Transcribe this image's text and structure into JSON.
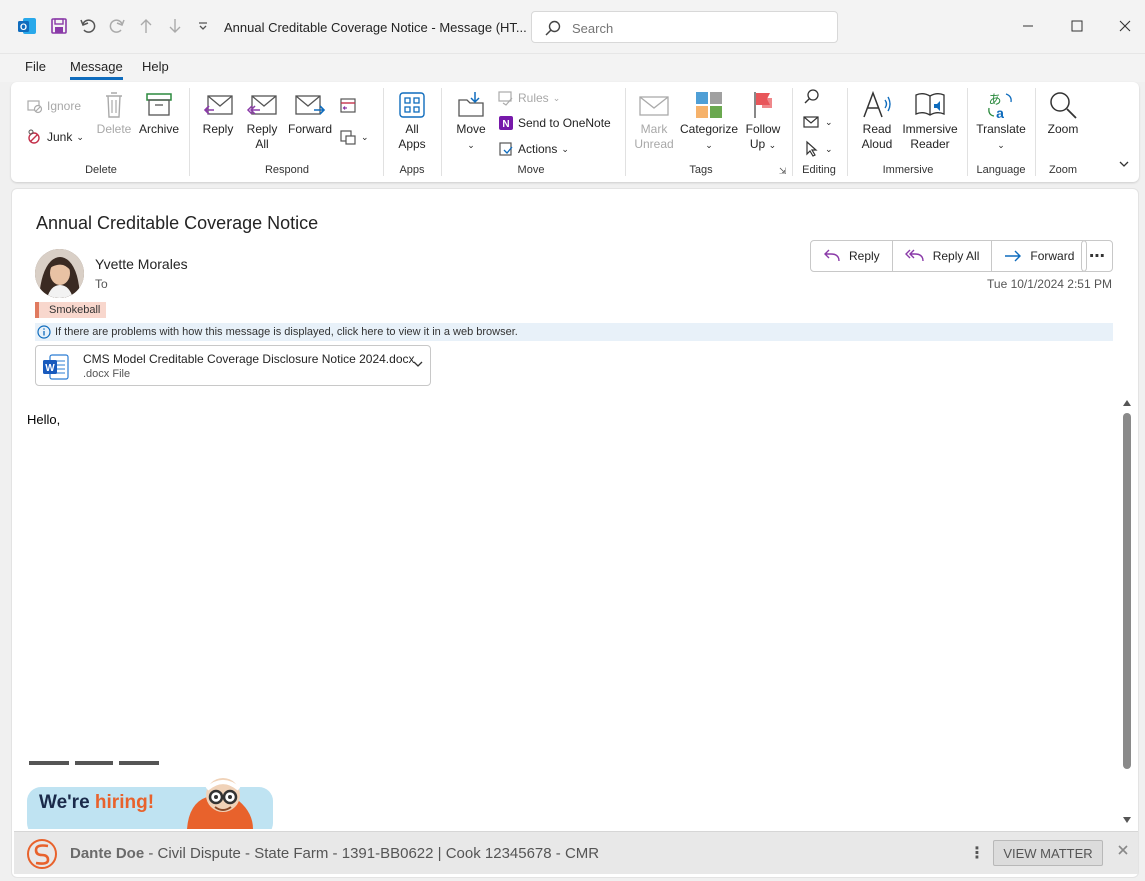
{
  "titlebar": {
    "title": "Annual Creditable Coverage Notice  -  Message (HT...",
    "search_placeholder": "Search"
  },
  "menu": {
    "file": "File",
    "message": "Message",
    "help": "Help"
  },
  "ribbon": {
    "delete_group": {
      "label": "Delete",
      "ignore": "Ignore",
      "junk": "Junk",
      "delete": "Delete",
      "archive": "Archive"
    },
    "respond_group": {
      "label": "Respond",
      "reply": "Reply",
      "reply_all_1": "Reply",
      "reply_all_2": "All",
      "forward": "Forward"
    },
    "apps_group": {
      "label": "Apps",
      "all_apps_1": "All",
      "all_apps_2": "Apps"
    },
    "move_group": {
      "label": "Move",
      "move": "Move",
      "rules": "Rules",
      "onenote": "Send to OneNote",
      "actions": "Actions"
    },
    "tags_group": {
      "label": "Tags",
      "mark_unread_1": "Mark",
      "mark_unread_2": "Unread",
      "categorize": "Categorize",
      "follow_up_1": "Follow",
      "follow_up_2": "Up"
    },
    "editing_group": {
      "label": "Editing"
    },
    "immersive_group": {
      "label": "Immersive",
      "read_aloud_1": "Read",
      "read_aloud_2": "Aloud",
      "immersive_reader_1": "Immersive",
      "immersive_reader_2": "Reader"
    },
    "language_group": {
      "label": "Language",
      "translate": "Translate"
    },
    "zoom_group": {
      "label": "Zoom",
      "zoom": "Zoom"
    }
  },
  "message": {
    "subject": "Annual Creditable Coverage Notice",
    "sender": "Yvette Morales",
    "to_label": "To",
    "datetime": "Tue 10/1/2024 2:51 PM",
    "category": "Smokeball",
    "info_bar": "If there are problems with how this message is displayed, click here to view it in a web browser.",
    "attachment": {
      "name": "CMS Model Creditable Coverage Disclosure Notice 2024.docx",
      "type": ".docx File"
    },
    "actions": {
      "reply": "Reply",
      "reply_all": "Reply All",
      "forward": "Forward"
    },
    "body_greeting": "Hello,",
    "banner_text_1": "We're",
    "banner_text_2": "hiring!"
  },
  "smokeball": {
    "matter_name": "Dante Doe",
    "matter_detail": " - Civil Dispute - State Farm - 1391-BB0622 | Cook 12345678 - CMR",
    "view_button": "VIEW MATTER"
  },
  "colors": {
    "accent": "#0f6cbd",
    "word_blue": "#185abd",
    "onenote_purple": "#7719aa",
    "smokeball_orange": "#e8622c",
    "category_tag": "#f8d7cd"
  }
}
